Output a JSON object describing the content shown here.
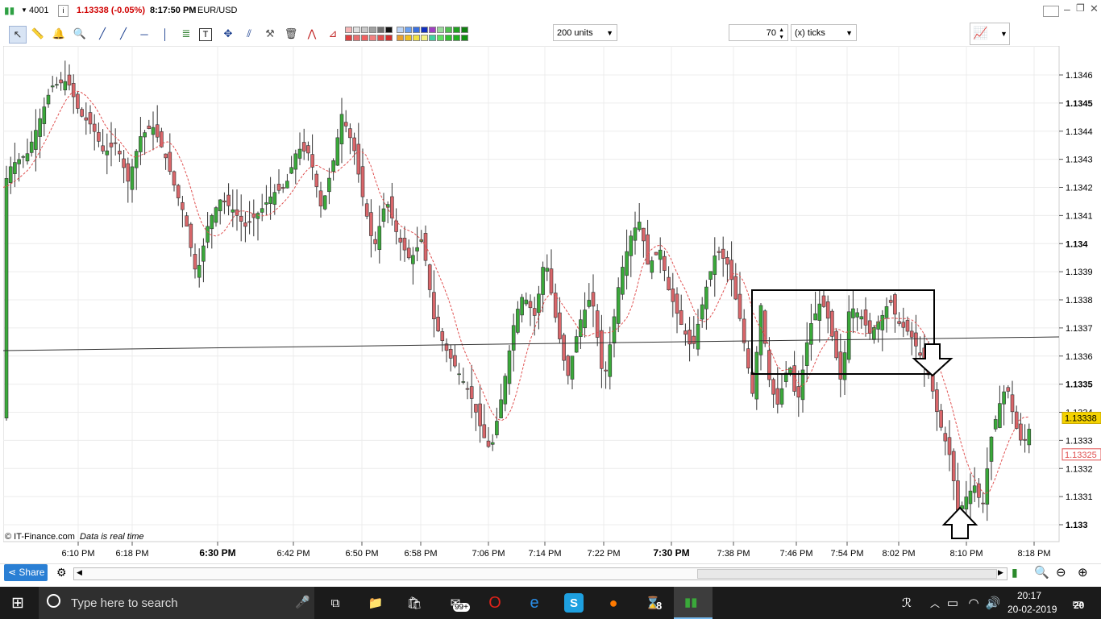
{
  "titlebar": {
    "account": "4001",
    "info_icon": "i",
    "price": "1.13338 (-0.05%)",
    "time": "8:17:50 PM",
    "symbol": "EUR/USD"
  },
  "toolbar": {
    "units_value": "200 units",
    "ticks_value": "70",
    "ticks_type": "(x) ticks"
  },
  "chart_data": {
    "type": "candlestick",
    "symbol": "EUR/USD",
    "ylim": [
      1.13295,
      1.13465
    ],
    "y_ticks": [
      "1.1346",
      "1.1345",
      "1.1344",
      "1.1343",
      "1.1342",
      "1.1341",
      "1.134",
      "1.1339",
      "1.1338",
      "1.1337",
      "1.1336",
      "1.1335",
      "1.1334",
      "1.1333",
      "1.1332",
      "1.1331",
      "1.133"
    ],
    "y_tick_bold": [
      "1.1345",
      "1.134",
      "1.1335",
      "1.133"
    ],
    "x_ticks": [
      "6:10 PM",
      "6:18 PM",
      "6:30 PM",
      "6:42 PM",
      "6:50 PM",
      "6:58 PM",
      "7:06 PM",
      "7:14 PM",
      "7:22 PM",
      "7:30 PM",
      "7:38 PM",
      "7:46 PM",
      "7:54 PM",
      "8:02 PM",
      "8:10 PM",
      "8:18 PM"
    ],
    "x_tick_bold": [
      "6:30 PM",
      "7:30 PM"
    ],
    "current_price_label": "1.13338",
    "ma_price_label": "1.13325",
    "watermark": "© IT-Finance.com",
    "watermark_note": "Data is real time",
    "colors": {
      "up": "#3aa93a",
      "down": "#d9666a",
      "ma": "#e05050",
      "price_tag": "#f5d300"
    }
  },
  "scroll": {
    "share_label": "Share"
  },
  "taskbar": {
    "search_placeholder": "Type here to search",
    "time": "20:17",
    "date": "20-02-2019",
    "notif_count": "20",
    "store_badge": "99+",
    "app_badge": "8"
  }
}
